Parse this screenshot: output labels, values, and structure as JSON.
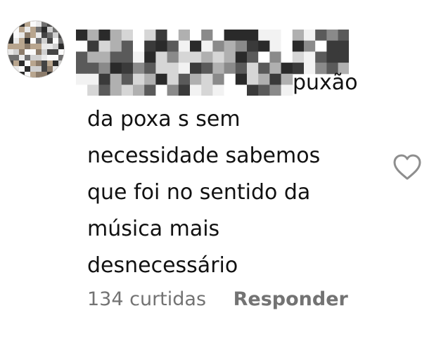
{
  "comment": {
    "username_redacted": true,
    "text_lines": [
      "puxão",
      "da poxa s sem",
      "necessidade sabemos",
      "que foi no sentido da",
      "música mais",
      "desnecessário"
    ]
  },
  "actions": {
    "likes_label": "134 curtidas",
    "reply_label": "Responder"
  },
  "icons": {
    "like": "heart-outline-icon"
  },
  "colors": {
    "text": "#111111",
    "meta": "#737373",
    "icon": "#8e8e8e"
  }
}
